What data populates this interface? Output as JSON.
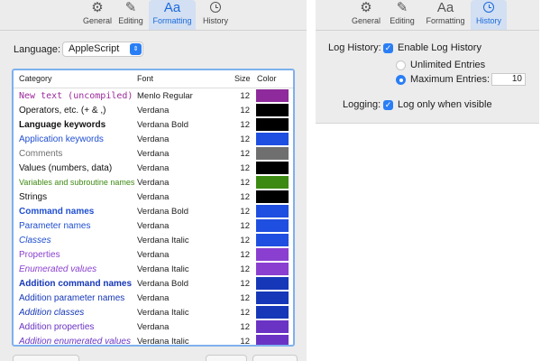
{
  "toolbar": {
    "items": [
      {
        "label": "General",
        "icon": "gear-icon"
      },
      {
        "label": "Editing",
        "icon": "pencil-icon"
      },
      {
        "label": "Formatting",
        "icon": "text-format-icon",
        "glyph": "Aa"
      },
      {
        "label": "History",
        "icon": "clock-icon"
      }
    ]
  },
  "formatting": {
    "language_label": "Language:",
    "language_value": "AppleScript",
    "columns": [
      "Category",
      "Font",
      "Size",
      "Color"
    ],
    "rows": [
      {
        "category": "New text (uncompiled)",
        "font": "Menlo Regular",
        "size": "12",
        "color": "#8e2a9b"
      },
      {
        "category": "Operators, etc. (+ & ,)",
        "font": "Verdana",
        "size": "12",
        "color": "#000000"
      },
      {
        "category": "Language keywords",
        "font": "Verdana Bold",
        "size": "12",
        "color": "#000000"
      },
      {
        "category": "Application keywords",
        "font": "Verdana",
        "size": "12",
        "color": "#1f4fe0"
      },
      {
        "category": "Comments",
        "font": "Verdana",
        "size": "12",
        "color": "#6f6f6f"
      },
      {
        "category": "Values (numbers, data)",
        "font": "Verdana",
        "size": "12",
        "color": "#000000"
      },
      {
        "category": "Variables and subroutine names",
        "font": "Verdana",
        "size": "12",
        "color": "#3d8a12"
      },
      {
        "category": "Strings",
        "font": "Verdana",
        "size": "12",
        "color": "#000000"
      },
      {
        "category": "Command names",
        "font": "Verdana Bold",
        "size": "12",
        "color": "#1f4fe0"
      },
      {
        "category": "Parameter names",
        "font": "Verdana",
        "size": "12",
        "color": "#1f4fe0"
      },
      {
        "category": "Classes",
        "font": "Verdana Italic",
        "size": "12",
        "color": "#1f4fe0"
      },
      {
        "category": "Properties",
        "font": "Verdana",
        "size": "12",
        "color": "#8a3fd0"
      },
      {
        "category": "Enumerated values",
        "font": "Verdana Italic",
        "size": "12",
        "color": "#8a3fd0"
      },
      {
        "category": "Addition command names",
        "font": "Verdana Bold",
        "size": "12",
        "color": "#1537b8"
      },
      {
        "category": "Addition parameter names",
        "font": "Verdana",
        "size": "12",
        "color": "#1537b8"
      },
      {
        "category": "Addition classes",
        "font": "Verdana Italic",
        "size": "12",
        "color": "#1537b8"
      },
      {
        "category": "Addition properties",
        "font": "Verdana",
        "size": "12",
        "color": "#6a33c4"
      },
      {
        "category": "Addition enumerated values",
        "font": "Verdana Italic",
        "size": "12",
        "color": "#6a33c4"
      }
    ]
  },
  "history": {
    "log_history_label": "Log History:",
    "enable_label": "Enable Log History",
    "unlimited_label": "Unlimited Entries",
    "maximum_label": "Maximum Entries:",
    "maximum_value": "10",
    "logging_label": "Logging:",
    "log_visible_label": "Log only when visible"
  },
  "colors": {
    "accent": "#2a7ef5",
    "selected_tab_bg": "#d3dff2"
  }
}
